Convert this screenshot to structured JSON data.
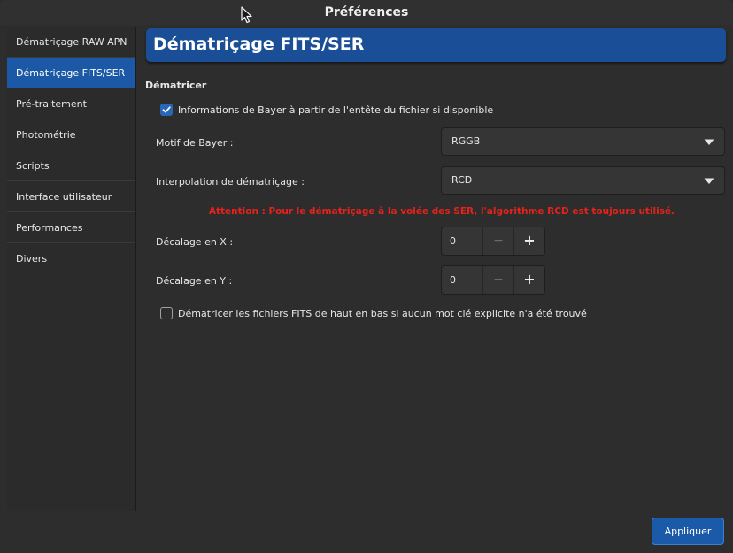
{
  "window": {
    "title": "Préférences"
  },
  "sidebar": {
    "items": [
      {
        "label": "Dématriçage RAW APN"
      },
      {
        "label": "Dématriçage FITS/SER"
      },
      {
        "label": "Pré-traitement"
      },
      {
        "label": "Photométrie"
      },
      {
        "label": "Scripts"
      },
      {
        "label": "Interface utilisateur"
      },
      {
        "label": "Performances"
      },
      {
        "label": "Divers"
      }
    ],
    "active_index": 1
  },
  "main": {
    "page_title": "Dématriçage FITS/SER",
    "section_title": "Dématricer",
    "bayer_header_checkbox": {
      "label": "Informations de Bayer à partir de l'entête du fichier si disponible",
      "checked": true
    },
    "bayer_pattern": {
      "label": "Motif de Bayer :",
      "value": "RGGB"
    },
    "interpolation": {
      "label": "Interpolation de dématriçage :",
      "value": "RCD"
    },
    "warning": "Attention : Pour le dématriçage à la volée des SER, l'algorithme RCD est toujours utilisé.",
    "offset_x": {
      "label": "Décalage en X :",
      "value": "0",
      "minus": "−",
      "plus": "+"
    },
    "offset_y": {
      "label": "Décalage en Y :",
      "value": "0",
      "minus": "−",
      "plus": "+"
    },
    "top_down_checkbox": {
      "label": "Dématricer les fichiers FITS de haut en bas si aucun mot clé explicite n'a été trouvé",
      "checked": false
    }
  },
  "footer": {
    "apply_label": "Appliquer"
  },
  "icons": {
    "cursor": "mouse-pointer-icon",
    "checkmark": "checkmark-icon",
    "dropdown": "chevron-down-icon"
  },
  "colors": {
    "accent": "#1b59a6",
    "warning": "#e5221b",
    "background": "#2d2d2d"
  }
}
